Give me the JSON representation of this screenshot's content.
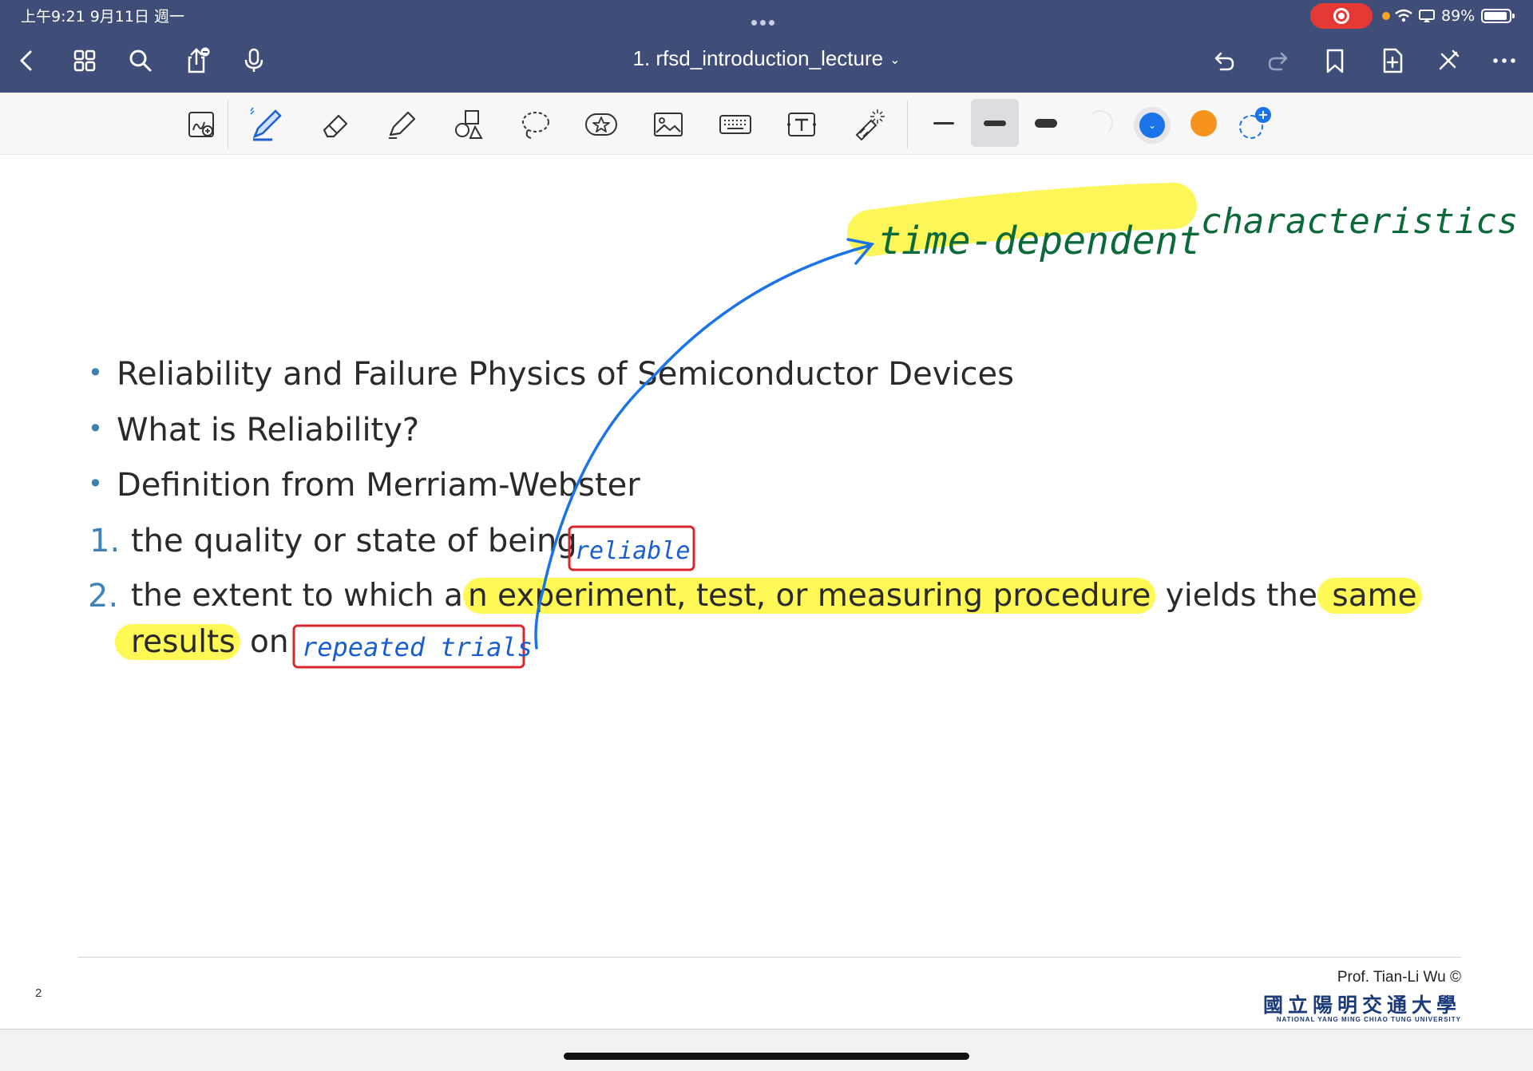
{
  "status_bar": {
    "time_date": "上午9:21  9月11日 週一",
    "battery": "89%"
  },
  "nav": {
    "doc_title": "1. rfsd_introduction_lecture",
    "icons": [
      "back-icon",
      "thumbnails-icon",
      "search-icon",
      "share-icon",
      "microphone-icon",
      "undo-icon",
      "redo-icon",
      "bookmark-icon",
      "add-page-icon",
      "close-toolbar-icon",
      "more-icon"
    ]
  },
  "toolbar": {
    "tools": [
      "scan-icon",
      "pen-icon",
      "eraser-icon",
      "highlighter-icon",
      "shapes-icon",
      "lasso-icon",
      "sticker-icon",
      "image-icon",
      "keyboard-icon",
      "text-box-icon",
      "laser-pointer-icon"
    ],
    "colors": {
      "selected": "#1a73e8",
      "secondary": "#f5931c",
      "light": "#e8e8e8"
    }
  },
  "slide": {
    "bullets": [
      "Reliability and Failure Physics of Semiconductor Devices",
      "What is Reliability?",
      "Definition from Merriam-Webster"
    ],
    "item1": {
      "num": "1.",
      "text": "the quality or state of being"
    },
    "item2": {
      "num": "2.",
      "a": "the extent to which a",
      "b": "n experiment, test, or measuring procedure",
      "c": " yields the",
      "d": " same",
      "e": "results",
      "f": " on"
    },
    "page_number": "2",
    "credit": "Prof. Tian-Li Wu ©",
    "university_cn": "國立陽明交通大學",
    "university_en": "NATIONAL YANG MING CHIAO TUNG UNIVERSITY"
  },
  "annotations": {
    "reliable": "reliable",
    "repeated_trials": "repeated trials",
    "time_dependent": "time-dependent",
    "characteristics": "characteristics"
  }
}
